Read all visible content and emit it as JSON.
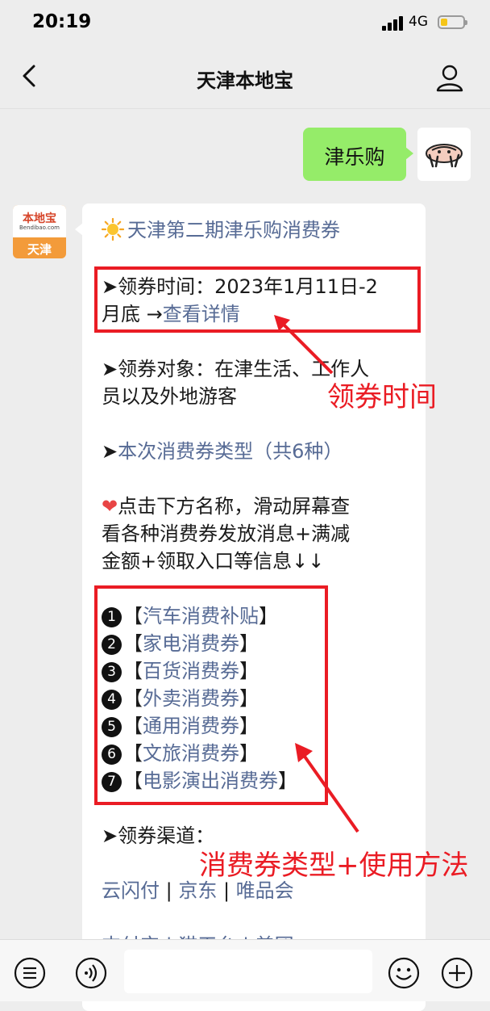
{
  "status": {
    "time": "20:19",
    "network": "4G"
  },
  "nav": {
    "title": "天津本地宝"
  },
  "chat": {
    "user_message": "津乐购",
    "sender_avatar": {
      "brand": "本地宝",
      "url": "Bendibao.com",
      "city": "天津"
    },
    "article": {
      "title": "天津第二期津乐购消费券",
      "time_label": "➤领券时间：2023年1月11日-2",
      "time_label_cont": "月底 →",
      "time_link": "查看详情",
      "target_label_1": "➤领券对象：在津生活、工作人",
      "target_label_2": "员以及外地游客",
      "type_prefix": "➤",
      "type_link": "本次消费券类型（共6种）",
      "tip_1": "点击下方名称，滑动屏幕查",
      "tip_2": "看各种消费券发放消息+满减",
      "tip_3": "金额+领取入口等信息↓↓",
      "coupons": [
        {
          "n": "1",
          "name": "汽车消费补贴"
        },
        {
          "n": "2",
          "name": "家电消费券"
        },
        {
          "n": "3",
          "name": "百货消费券"
        },
        {
          "n": "4",
          "name": "外卖消费券"
        },
        {
          "n": "5",
          "name": "通用消费券"
        },
        {
          "n": "6",
          "name": "文旅消费券"
        },
        {
          "n": "7",
          "name": "电影演出消费券"
        }
      ],
      "bracket_open": "【",
      "bracket_close": "】",
      "channel_label": "➤领券渠道：",
      "channels": [
        "云闪付",
        "京东",
        "唯品会"
      ],
      "sep": " | ",
      "channels_2_partial": "支付宝 | 猫天台 | 美团"
    }
  },
  "annotations": {
    "time_note": "领券时间",
    "type_note": "消费券类型+使用方法",
    "color": "#ea1c24"
  },
  "icons": [
    "back-icon",
    "profile-icon",
    "sun-icon",
    "heart-icon",
    "voice-menu-icon",
    "voice-icon",
    "emoji-icon",
    "plus-icon"
  ]
}
